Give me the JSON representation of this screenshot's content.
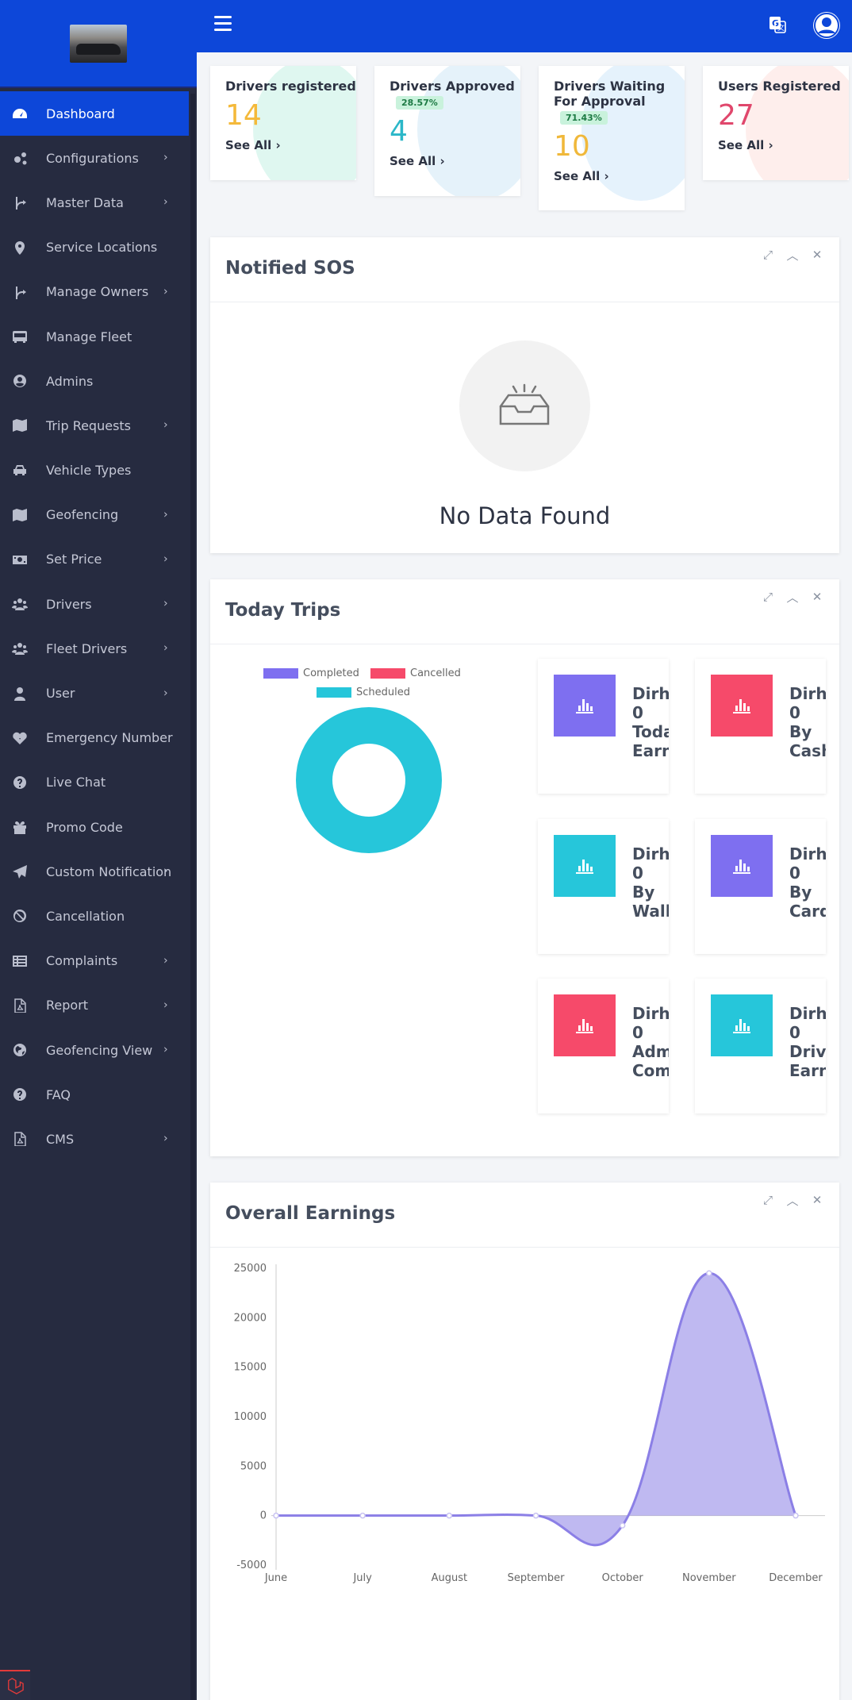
{
  "sidebar": {
    "items": [
      {
        "label": "Dashboard",
        "icon": "dashboard-icon",
        "active": true,
        "chevron": false
      },
      {
        "label": "Configurations",
        "icon": "cogs-icon",
        "chevron": true
      },
      {
        "label": "Master Data",
        "icon": "branch-icon",
        "chevron": true
      },
      {
        "label": "Service Locations",
        "icon": "map-pin-icon",
        "chevron": false
      },
      {
        "label": "Manage Owners",
        "icon": "branch-icon",
        "chevron": true
      },
      {
        "label": "Manage Fleet",
        "icon": "bus-icon",
        "chevron": false
      },
      {
        "label": "Admins",
        "icon": "user-circle-icon",
        "chevron": false
      },
      {
        "label": "Trip Requests",
        "icon": "map-icon",
        "chevron": true
      },
      {
        "label": "Vehicle Types",
        "icon": "taxi-icon",
        "chevron": false
      },
      {
        "label": "Geofencing",
        "icon": "map-icon",
        "chevron": true
      },
      {
        "label": "Set Price",
        "icon": "money-icon",
        "chevron": true
      },
      {
        "label": "Drivers",
        "icon": "users-icon",
        "chevron": true
      },
      {
        "label": "Fleet Drivers",
        "icon": "users-icon",
        "chevron": true
      },
      {
        "label": "User",
        "icon": "user-icon",
        "chevron": true
      },
      {
        "label": "Emergency Number",
        "icon": "heartbeat-icon",
        "chevron": false
      },
      {
        "label": "Live Chat",
        "icon": "question-circle-icon",
        "chevron": false
      },
      {
        "label": "Promo Code",
        "icon": "gift-icon",
        "chevron": false
      },
      {
        "label": "Custom Notification",
        "icon": "paper-plane-icon",
        "chevron": true
      },
      {
        "label": "Cancellation",
        "icon": "ban-icon",
        "chevron": false
      },
      {
        "label": "Complaints",
        "icon": "list-icon",
        "chevron": true
      },
      {
        "label": "Report",
        "icon": "pdf-file-icon",
        "chevron": true
      },
      {
        "label": "Geofencing View",
        "icon": "globe-icon",
        "chevron": true
      },
      {
        "label": "FAQ",
        "icon": "question-circle-icon",
        "chevron": false
      },
      {
        "label": "CMS",
        "icon": "pdf-file-icon",
        "chevron": true
      }
    ]
  },
  "stats": [
    {
      "title": "Drivers registered",
      "value": "14",
      "badge": "",
      "see": "See All",
      "color": "#f4b93a",
      "bg": "#c5f0e4"
    },
    {
      "title": "Drivers Approved",
      "value": "4",
      "badge": "28.57%",
      "see": "See All",
      "color": "#2bb7c8",
      "bg": "#cfe8f6"
    },
    {
      "title": "Drivers Waiting For Approval",
      "value": "10",
      "badge": "71.43%",
      "see": "See All",
      "color": "#f0b83a",
      "bg": "#cfe8fa"
    },
    {
      "title": "Users Registered",
      "value": "27",
      "badge": "",
      "see": "See All",
      "color": "#e0476c",
      "bg": "#fde0dc"
    }
  ],
  "sos": {
    "title": "Notified SOS",
    "empty": "No Data Found"
  },
  "trips": {
    "title": "Today Trips",
    "legend": [
      {
        "label": "Completed",
        "color": "#7e6ff0"
      },
      {
        "label": "Cancelled",
        "color": "#f64a6a"
      },
      {
        "label": "Scheduled",
        "color": "#26c6da"
      }
    ],
    "cards": [
      {
        "lines": [
          "Dirham",
          "0",
          "Today",
          "Earning"
        ],
        "color": "#7e6ff0"
      },
      {
        "lines": [
          "Dirham",
          "0",
          "By",
          "Cash"
        ],
        "color": "#f64a6a"
      },
      {
        "lines": [
          "Dirham",
          "0",
          "By",
          "Wallet"
        ],
        "color": "#26c6da"
      },
      {
        "lines": [
          "Dirham",
          "0",
          "By",
          "Card/Or"
        ],
        "color": "#7e6ff0"
      },
      {
        "lines": [
          "Dirham",
          "0",
          "Admin",
          "Commis"
        ],
        "color": "#f64a6a"
      },
      {
        "lines": [
          "Dirham",
          "0",
          "Driver",
          "Earnings"
        ],
        "color": "#26c6da"
      }
    ]
  },
  "earnings": {
    "title": "Overall Earnings"
  },
  "chart_data": {
    "type": "area",
    "categories": [
      "June",
      "July",
      "August",
      "September",
      "October",
      "November",
      "December"
    ],
    "series": [
      {
        "values": [
          0,
          0,
          0,
          0,
          -1000,
          24500,
          0
        ],
        "color": "#8b7fe6"
      }
    ],
    "ylim": [
      -5000,
      25000
    ],
    "yticks": [
      25000,
      20000,
      15000,
      10000,
      5000,
      0,
      -5000
    ],
    "grid": false
  }
}
